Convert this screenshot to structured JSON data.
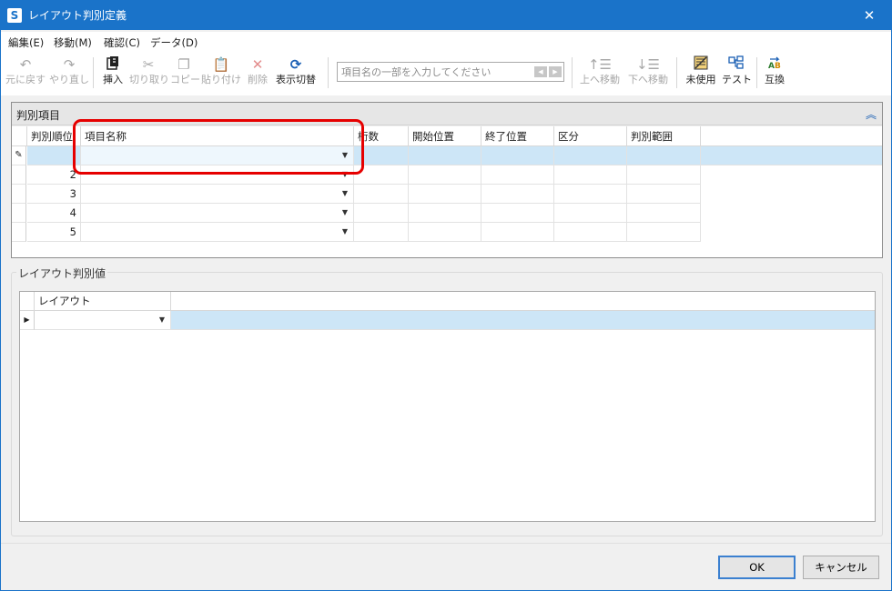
{
  "window": {
    "title": "レイアウト判別定義",
    "logo_letter": "S",
    "close_glyph": "✕"
  },
  "menu": {
    "items": [
      "編集(E)",
      "移動(M)",
      "確認(C)",
      "データ(D)"
    ]
  },
  "toolbar": {
    "undo": "元に戻す",
    "redo": "やり直し",
    "insert": "挿入",
    "cut": "切り取り",
    "copy": "コピー",
    "paste": "貼り付け",
    "delete": "削除",
    "toggle_display": "表示切替",
    "search_placeholder": "項目名の一部を入力してください",
    "move_up": "上へ移動",
    "move_down": "下へ移動",
    "unused": "未使用",
    "test": "テスト",
    "swap": "互換"
  },
  "panel1": {
    "title": "判別項目",
    "columns": [
      "判別順位",
      "項目名称",
      "桁数",
      "開始位置",
      "終了位置",
      "区分",
      "判別範囲"
    ],
    "rows": [
      {
        "order": "",
        "name": ""
      },
      {
        "order": "2",
        "name": ""
      },
      {
        "order": "3",
        "name": ""
      },
      {
        "order": "4",
        "name": ""
      },
      {
        "order": "5",
        "name": ""
      }
    ]
  },
  "panel2": {
    "title": "レイアウト判別値",
    "columns": [
      "レイアウト"
    ],
    "rows": [
      {
        "layout": ""
      }
    ]
  },
  "footer": {
    "ok": "OK",
    "cancel": "キャンセル"
  },
  "colors": {
    "titlebar": "#1a73c9",
    "selected_row": "#cde6f7",
    "highlight": "#e60000"
  }
}
